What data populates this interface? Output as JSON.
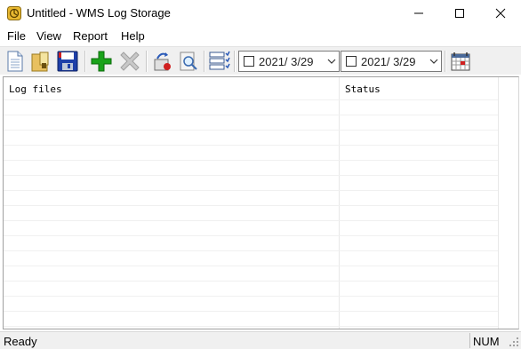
{
  "window": {
    "title": "Untitled - WMS Log Storage",
    "app_icon": "wms-log-icon"
  },
  "menu": {
    "items": [
      {
        "label": "File"
      },
      {
        "label": "View"
      },
      {
        "label": "Report"
      },
      {
        "label": "Help"
      }
    ]
  },
  "toolbar": {
    "buttons": [
      {
        "icon": "new-document-icon"
      },
      {
        "icon": "open-folder-icon"
      },
      {
        "icon": "save-disk-icon"
      },
      {
        "icon": "add-plus-icon"
      },
      {
        "icon": "delete-x-icon"
      },
      {
        "icon": "restore-archive-icon"
      },
      {
        "icon": "find-magnifier-icon"
      },
      {
        "icon": "list-view-icon"
      },
      {
        "icon": "calendar-icon"
      }
    ],
    "date_from": "2021/  3/29",
    "date_to": "2021/  3/29"
  },
  "list": {
    "columns": [
      {
        "label": "Log files"
      },
      {
        "label": "Status"
      }
    ],
    "rows": []
  },
  "status_bar": {
    "text": "Ready",
    "indicator": "NUM"
  },
  "colors": {
    "toolbar_bg": "#f0f0f0",
    "accent_green": "#1aa31a",
    "save_blue": "#1e3fa8"
  }
}
